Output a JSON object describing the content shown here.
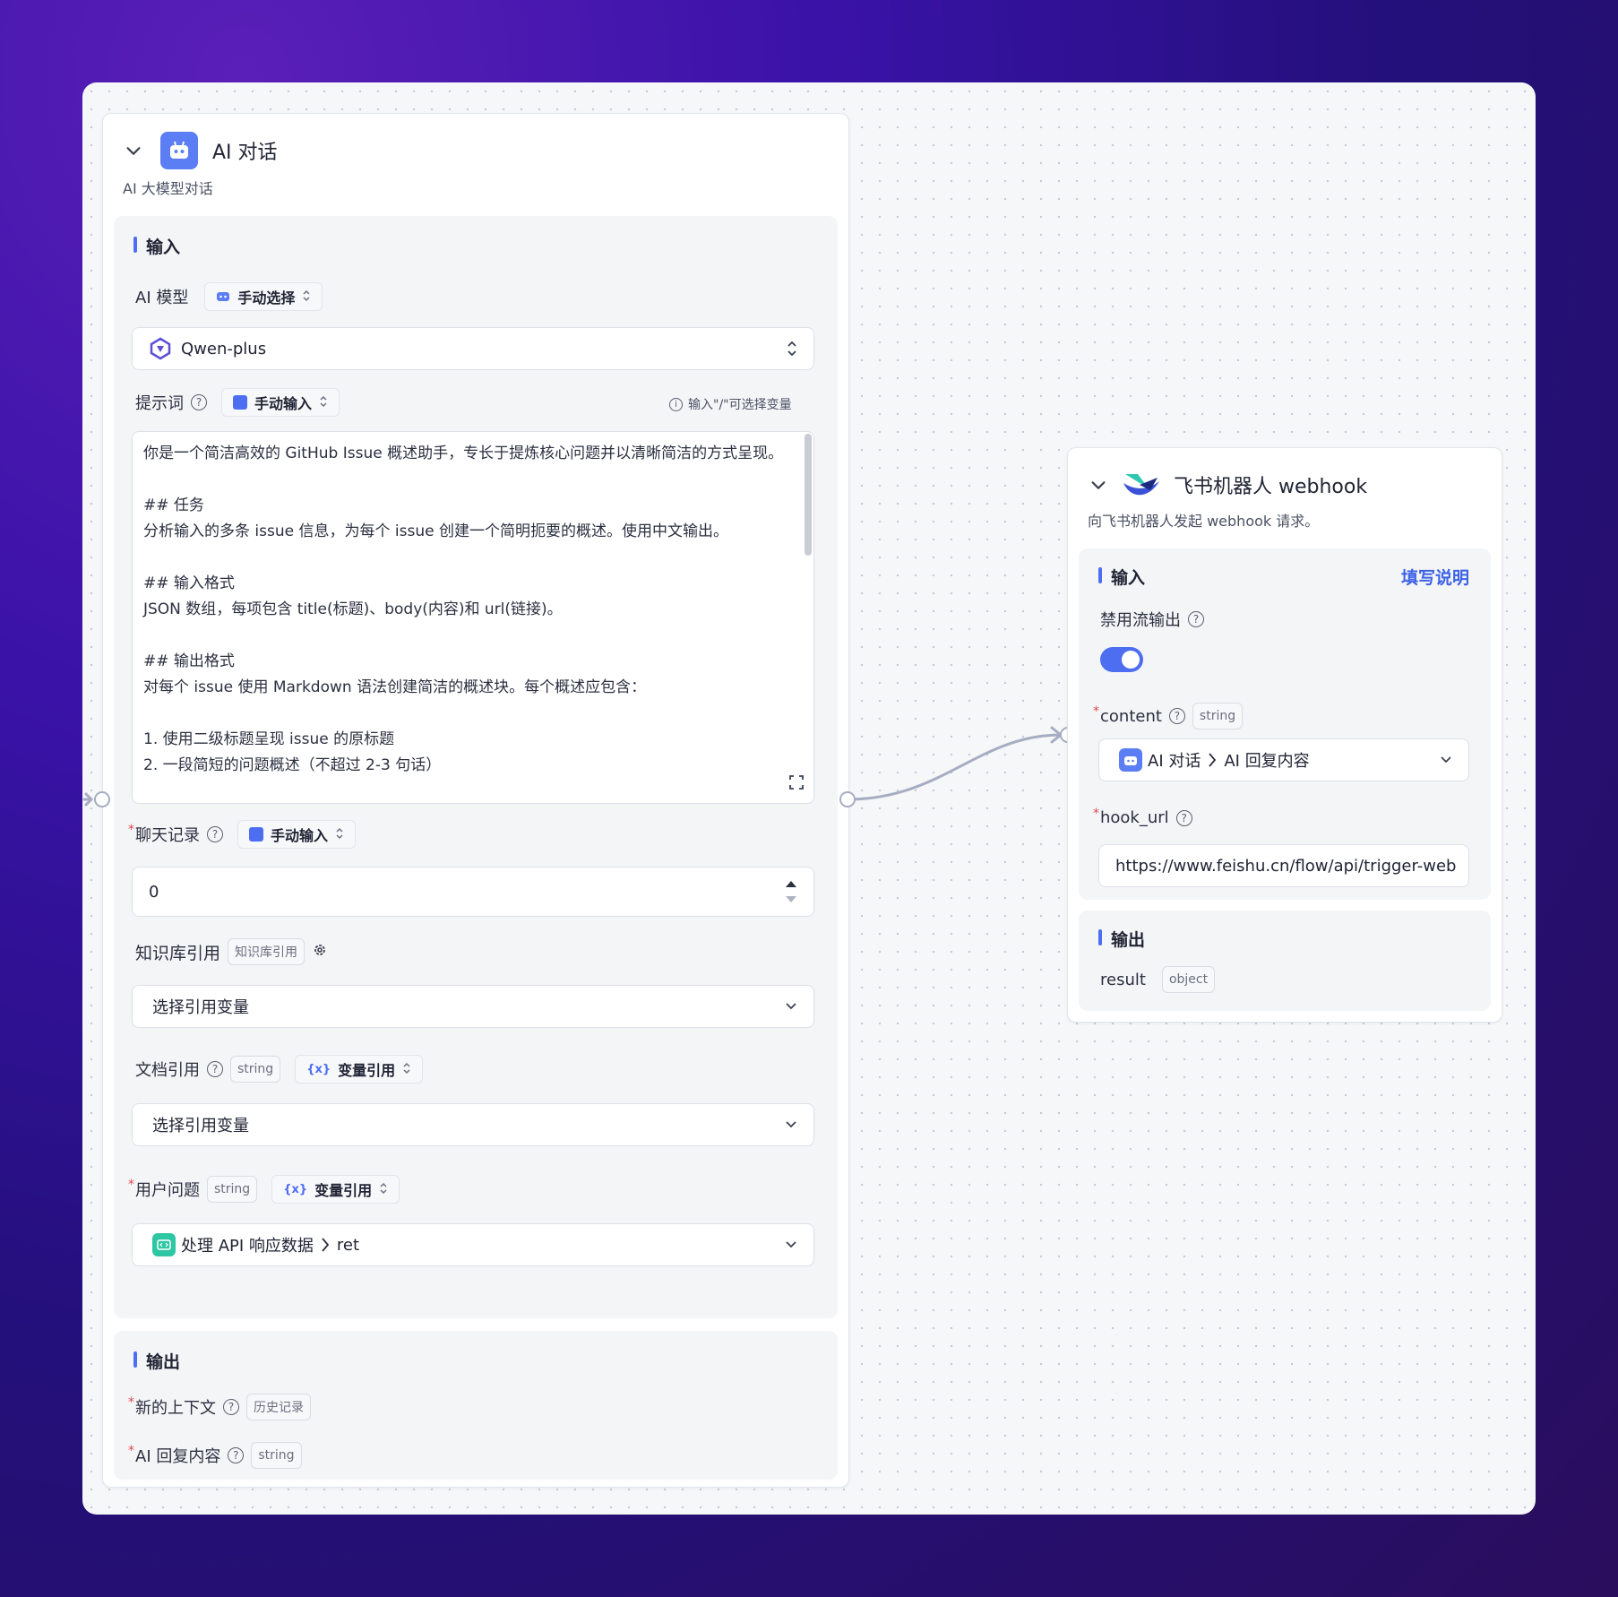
{
  "ai_node": {
    "title": "AI 对话",
    "subtitle": "AI 大模型对话",
    "input_section": {
      "title": "输入",
      "model_label": "AI 模型",
      "model_mode": "手动选择",
      "model_value": "Qwen-plus",
      "prompt_label": "提示词",
      "prompt_mode": "手动输入",
      "prompt_hint": "输入\"/\"可选择变量",
      "prompt_text": "你是一个简洁高效的 GitHub Issue 概述助手，专长于提炼核心问题并以清晰简洁的方式呈现。\n\n## 任务\n分析输入的多条 issue 信息，为每个 issue 创建一个简明扼要的概述。使用中文输出。\n\n## 输入格式\nJSON 数组，每项包含 title(标题)、body(内容)和 url(链接)。\n\n## 输出格式\n对每个 issue 使用 Markdown 语法创建简洁的概述块。每个概述应包含：\n\n1. 使用二级标题呈现 issue 的原标题\n2. 一段简短的问题概述（不超过 2-3 句话）",
      "history_label": "聊天记录",
      "history_mode": "手动输入",
      "history_value": "0",
      "kb_label": "知识库引用",
      "kb_tag": "知识库引用",
      "kb_placeholder": "选择引用变量",
      "doc_label": "文档引用",
      "doc_type": "string",
      "doc_mode": "变量引用",
      "doc_placeholder": "选择引用变量",
      "question_label": "用户问题",
      "question_type": "string",
      "question_mode": "变量引用",
      "question_source": "处理 API 响应数据",
      "question_field": "ret"
    },
    "output_section": {
      "title": "输出",
      "ctx_label": "新的上下文",
      "ctx_tag": "历史记录",
      "reply_label": "AI 回复内容",
      "reply_tag": "string"
    }
  },
  "feishu_node": {
    "title": "飞书机器人 webhook",
    "subtitle": "向飞书机器人发起 webhook 请求。",
    "input_section": {
      "title": "输入",
      "help_link": "填写说明",
      "stream_label": "禁用流输出",
      "stream_enabled": true,
      "content_label": "content",
      "content_type": "string",
      "content_source": "AI 对话",
      "content_field": "AI 回复内容",
      "hook_label": "hook_url",
      "hook_value": "https://www.feishu.cn/flow/api/trigger-web"
    },
    "output_section": {
      "title": "输出",
      "result_label": "result",
      "result_type": "object"
    }
  },
  "colors": {
    "accent": "#4e6ef2",
    "required": "#e5484d",
    "connector": "#a6adc2"
  }
}
